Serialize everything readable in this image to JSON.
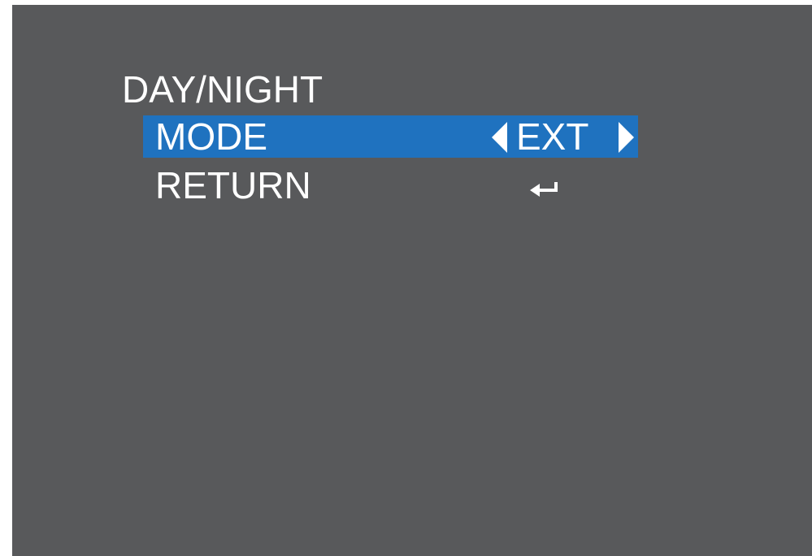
{
  "menu": {
    "title": "DAY/NIGHT",
    "items": [
      {
        "label": "MODE",
        "value": "EXT",
        "selected": true,
        "left_icon": "caret-left-icon",
        "right_icon": "caret-right-icon"
      },
      {
        "label": "RETURN",
        "icon": "enter-return-icon",
        "selected": false
      }
    ]
  },
  "colors": {
    "screen_background": "#58595b",
    "highlight": "#1f72bf",
    "text": "#ffffff",
    "outer_background": "#ffffff"
  }
}
